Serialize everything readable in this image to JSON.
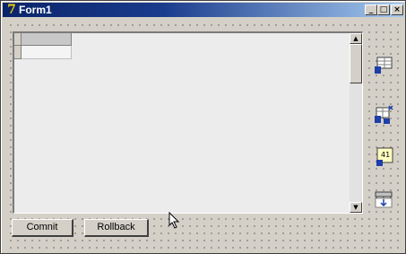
{
  "window": {
    "title": "Form1",
    "app_icon": "delphi-icon",
    "controls": {
      "minimize": "_",
      "maximize": "□",
      "close": "×"
    }
  },
  "grid": {
    "column_headers": [
      ""
    ],
    "rows": [
      [
        ""
      ]
    ],
    "scroll_up_glyph": "▲",
    "scroll_down_glyph": "▼"
  },
  "buttons": {
    "commit_label": "Comnit",
    "rollback_label": "Rollback"
  },
  "components": [
    {
      "icon": "database-table-icon"
    },
    {
      "icon": "database-query-icon"
    },
    {
      "icon": "datasource-icon"
    },
    {
      "icon": "database-transaction-icon"
    }
  ],
  "colors": {
    "title_bar_start": "#0a246a",
    "title_bar_end": "#a6caf0",
    "face": "#d4d0c8",
    "component_blue": "#1e3ea8"
  }
}
